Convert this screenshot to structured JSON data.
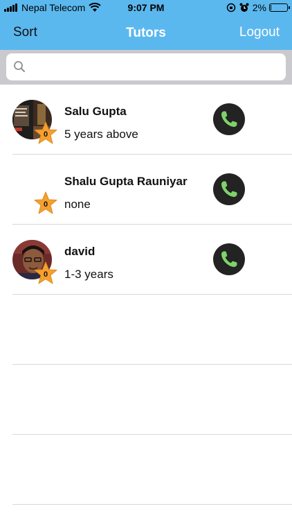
{
  "status_bar": {
    "carrier": "Nepal Telecom",
    "time": "9:07 PM",
    "battery": "2%"
  },
  "nav": {
    "sort_label": "Sort",
    "title": "Tutors",
    "logout_label": "Logout"
  },
  "search": {
    "placeholder": "",
    "value": ""
  },
  "tutors": [
    {
      "name": "Salu Gupta",
      "experience": "5 years above",
      "rating": "0",
      "has_photo": true
    },
    {
      "name": "Shalu Gupta Rauniyar",
      "experience": "none",
      "rating": "0",
      "has_photo": false
    },
    {
      "name": "david",
      "experience": "1-3 years",
      "rating": "0",
      "has_photo": true
    }
  ],
  "icons": {
    "call": "phone-icon",
    "rating": "star-icon",
    "search": "search-icon"
  },
  "colors": {
    "nav_background": "#5bb8ee",
    "star": "#f5a030",
    "call_button": "#232323",
    "phone_glyph": "#7ed36a"
  }
}
